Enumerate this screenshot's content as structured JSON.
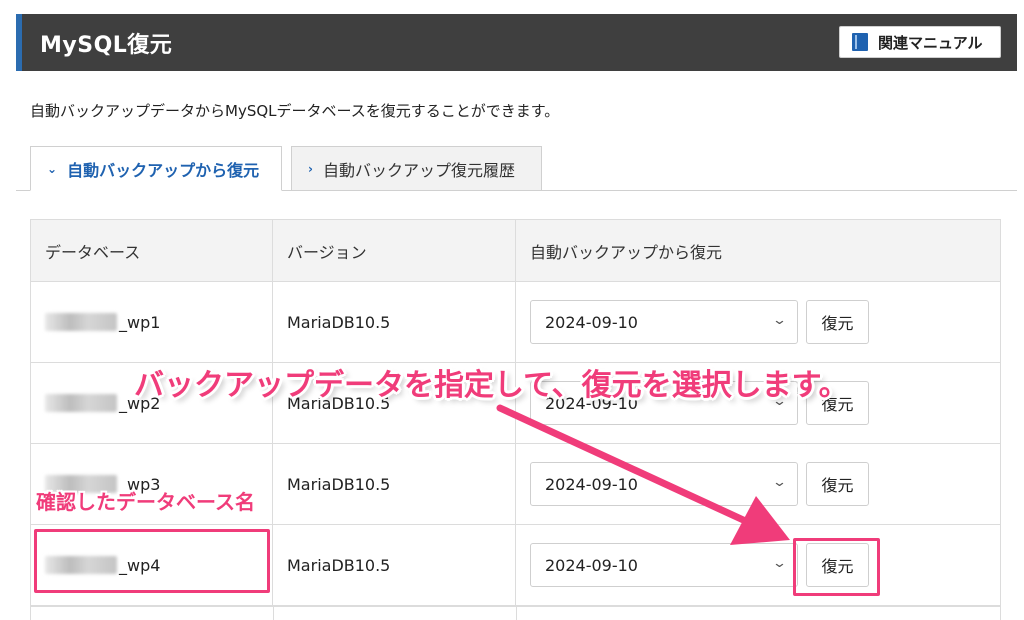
{
  "header": {
    "title": "MySQL復元",
    "manual_label": "関連マニュアル"
  },
  "description": "自動バックアップデータからMySQLデータベースを復元することができます。",
  "tabs": [
    {
      "label": "自動バックアップから復元",
      "active": true
    },
    {
      "label": "自動バックアップ復元履歴",
      "active": false
    }
  ],
  "table": {
    "columns": [
      "データベース",
      "バージョン",
      "自動バックアップから復元"
    ],
    "rows": [
      {
        "db_suffix": "_wp1",
        "version": "MariaDB10.5",
        "date": "2024-09-10",
        "button": "復元"
      },
      {
        "db_suffix": "_wp2",
        "version": "MariaDB10.5",
        "date": "2024-09-10",
        "button": "復元"
      },
      {
        "db_suffix": "_wp3",
        "version": "MariaDB10.5",
        "date": "2024-09-10",
        "button": "復元"
      },
      {
        "db_suffix": "_wp4",
        "version": "MariaDB10.5",
        "date": "2024-09-10",
        "button": "復元"
      }
    ]
  },
  "annotations": {
    "main": "バックアップデータを指定して、復元を選択します。",
    "db_name": "確認したデータベース名",
    "accent_color": "#f03c7a"
  },
  "colors": {
    "header_bg": "#3f3f3f",
    "brand_blue": "#1f62b0"
  }
}
